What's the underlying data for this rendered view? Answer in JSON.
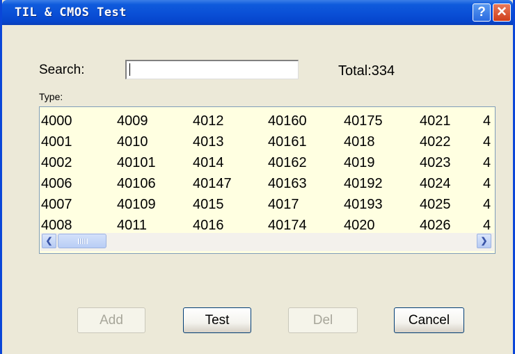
{
  "window": {
    "title": "TIL & CMOS Test",
    "help_glyph": "?",
    "close_glyph": "✕"
  },
  "search": {
    "label": "Search:",
    "value": "",
    "placeholder": ""
  },
  "total_label": "Total:334",
  "type_label": "Type:",
  "type_list": {
    "columns": [
      [
        "4000",
        "4001",
        "4002",
        "4006",
        "4007",
        "4008"
      ],
      [
        "4009",
        "4010",
        "40101",
        "40106",
        "40109",
        "4011"
      ],
      [
        "4012",
        "4013",
        "4014",
        "40147",
        "4015",
        "4016"
      ],
      [
        "40160",
        "40161",
        "40162",
        "40163",
        "4017",
        "40174"
      ],
      [
        "40175",
        "4018",
        "4019",
        "40192",
        "40193",
        "4020"
      ],
      [
        "4021",
        "4022",
        "4023",
        "4024",
        "4025",
        "4026"
      ],
      [
        "4",
        "4",
        "4",
        "4",
        "4",
        "4"
      ]
    ]
  },
  "scrollbar": {
    "left_arrow_icon": "chevron-left-icon",
    "right_arrow_icon": "chevron-right-icon",
    "left_glyph": "❮",
    "right_glyph": "❯"
  },
  "buttons": {
    "add": "Add",
    "test": "Test",
    "del": "Del",
    "cancel": "Cancel"
  },
  "colors": {
    "titlebar": "#0a4fd6",
    "list_background": "#ffffe1",
    "window_background": "#ece9d8",
    "disabled_text": "#a7a69a"
  }
}
